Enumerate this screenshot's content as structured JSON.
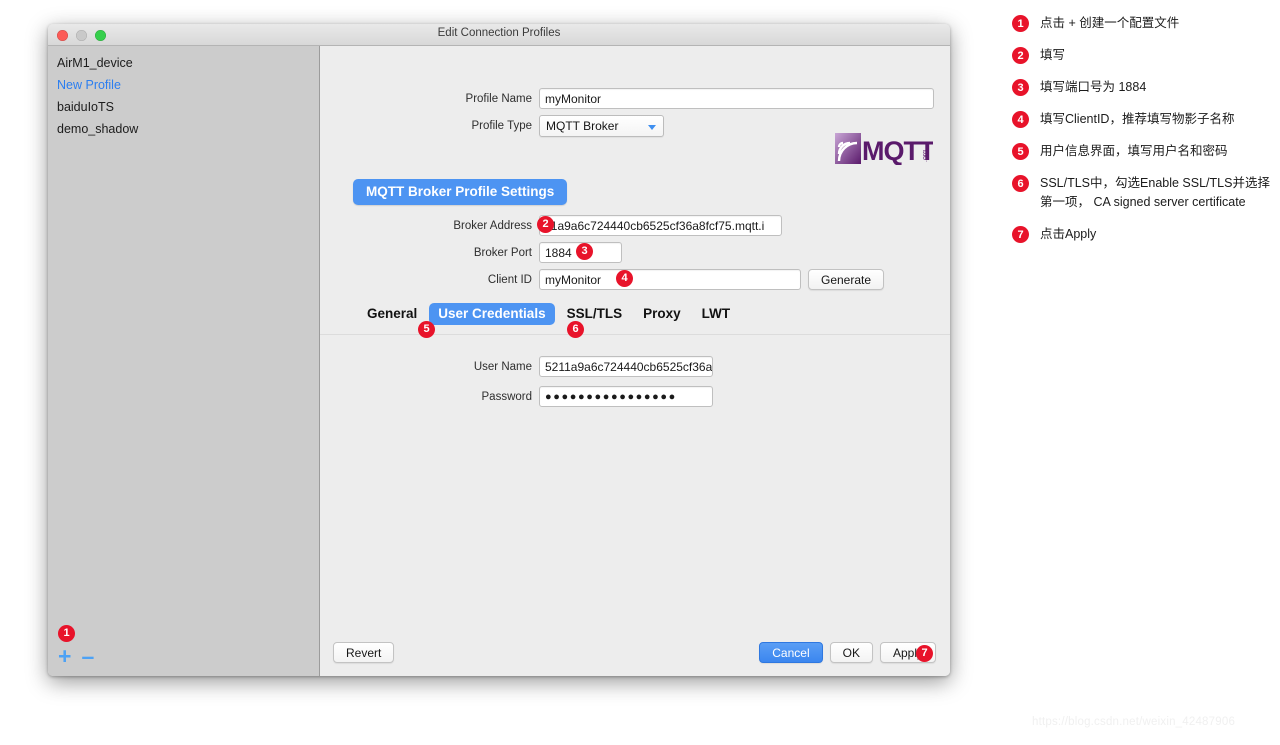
{
  "window": {
    "title": "Edit Connection Profiles",
    "traffic_lights": [
      "close-red",
      "minimize-gray",
      "zoom-green"
    ]
  },
  "sidebar": {
    "items": [
      {
        "label": "AirM1_device",
        "selected": false
      },
      {
        "label": "New Profile",
        "selected": true
      },
      {
        "label": "baiduIoTS",
        "selected": false
      },
      {
        "label": "demo_shadow",
        "selected": false
      }
    ],
    "add_label": "+",
    "remove_label": "–"
  },
  "form": {
    "profile_name_label": "Profile Name",
    "profile_name_value": "myMonitor",
    "profile_type_label": "Profile Type",
    "profile_type_value": "MQTT Broker",
    "settings_button": "MQTT Broker Profile Settings",
    "broker_address_label": "Broker Address",
    "broker_address_value": "11a9a6c724440cb6525cf36a8fcf75.mqtt.i",
    "broker_port_label": "Broker Port",
    "broker_port_value": "1884",
    "client_id_label": "Client ID",
    "client_id_value": "myMonitor",
    "generate_button": "Generate",
    "user_name_label": "User Name",
    "user_name_value": "5211a9a6c724440cb6525cf36a",
    "password_label": "Password",
    "password_value": "●●●●●●●●●●●●●●●●"
  },
  "tabs": [
    {
      "label": "General",
      "active": false
    },
    {
      "label": "User Credentials",
      "active": true
    },
    {
      "label": "SSL/TLS",
      "active": false
    },
    {
      "label": "Proxy",
      "active": false
    },
    {
      "label": "LWT",
      "active": false
    }
  ],
  "footer": {
    "revert": "Revert",
    "cancel": "Cancel",
    "ok": "OK",
    "apply": "Apply"
  },
  "badges": {
    "b1": "1",
    "b2": "2",
    "b3": "3",
    "b4": "4",
    "b5": "5",
    "b6": "6",
    "b7": "7"
  },
  "notes": [
    {
      "num": "1",
      "text": "点击 + 创建一个配置文件"
    },
    {
      "num": "2",
      "text": "填写"
    },
    {
      "num": "3",
      "text": "填写端口号为 1884"
    },
    {
      "num": "4",
      "text": "填写ClientID，推荐填写物影子名称"
    },
    {
      "num": "5",
      "text": "用户信息界面，填写用户名和密码"
    },
    {
      "num": "6",
      "text": "SSL/TLS中，勾选Enable SSL/TLS并选择 第一项， CA signed server certificate"
    },
    {
      "num": "7",
      "text": "点击Apply"
    }
  ],
  "watermark": "https://blog.csdn.net/weixin_42487906",
  "colors": {
    "accent_blue": "#4d94f2",
    "badge_red": "#e8132a",
    "logo_purple": "#6b2a7a"
  }
}
